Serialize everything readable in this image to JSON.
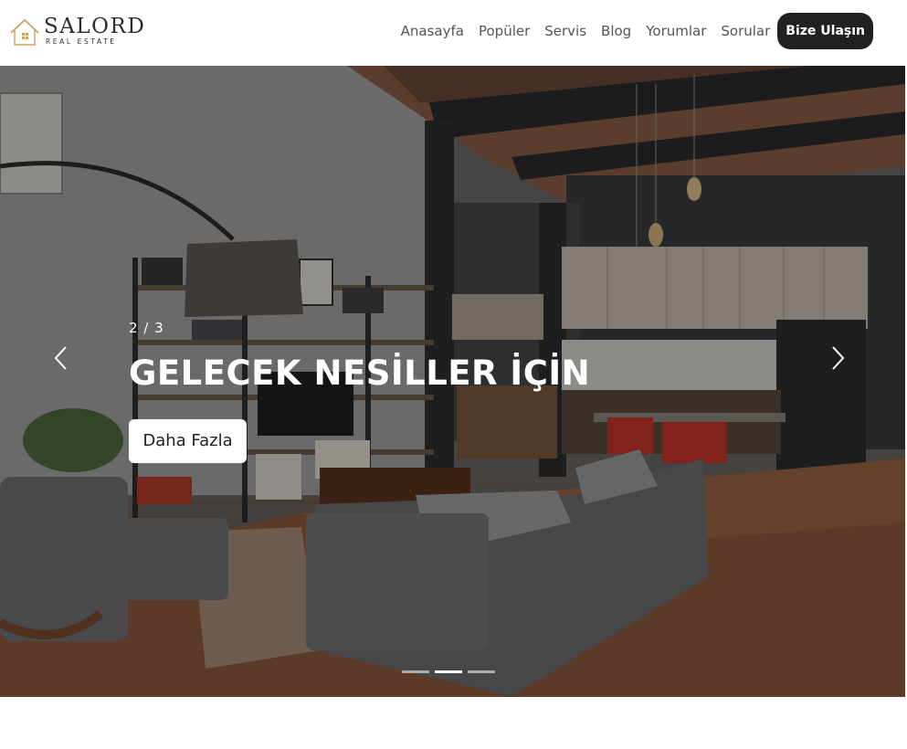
{
  "brand": {
    "name": "SALORD",
    "tagline": "REAL ESTATE",
    "accent": "#c9a25e"
  },
  "nav": {
    "links": [
      {
        "label": "Anasayfa"
      },
      {
        "label": "Popüler"
      },
      {
        "label": "Servis"
      },
      {
        "label": "Blog"
      },
      {
        "label": "Yorumlar"
      },
      {
        "label": "Sorular"
      }
    ],
    "cta_label": "Bize Ulaşın",
    "cta_color": "#212121"
  },
  "hero": {
    "counter": "2 / 3",
    "title": "GELECEK NESİLLER İÇİN",
    "button_label": "Daha Fazla",
    "prev_icon": "chevron-left-icon",
    "next_icon": "chevron-right-icon",
    "slide_count": 3,
    "active_slide": 2,
    "image": "loft living room with grey sofa, bookshelf, floor lamp, open kitchen with red chairs"
  }
}
